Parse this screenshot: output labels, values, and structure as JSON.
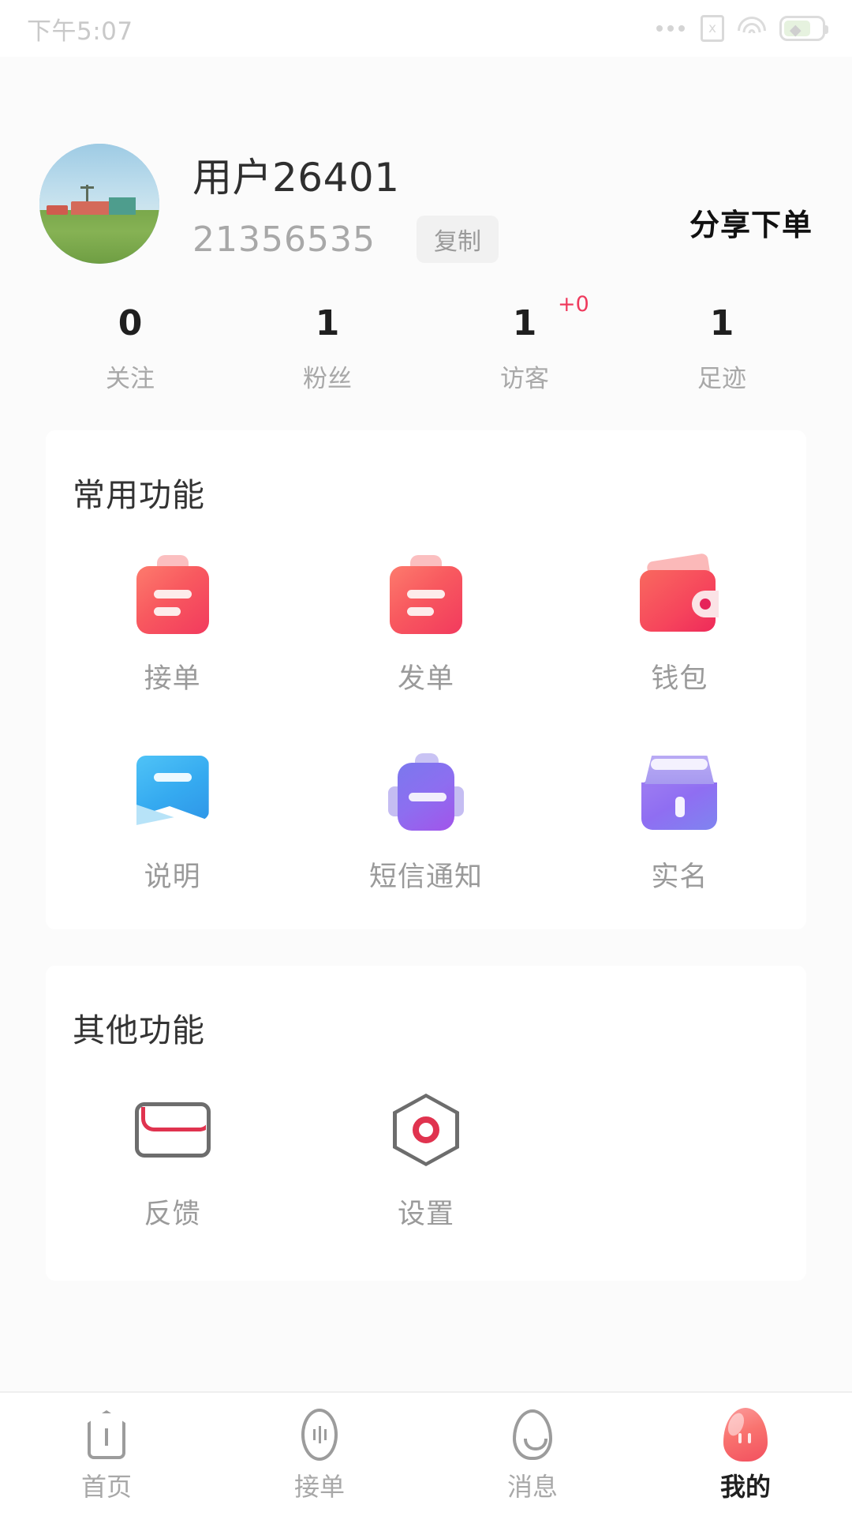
{
  "statusbar": {
    "time": "下午5:07",
    "icons": [
      "more-dots-icon",
      "sim-no-card-icon",
      "wifi-icon",
      "battery-charging-icon"
    ]
  },
  "profile": {
    "avatar_alt": "user-avatar-photo",
    "username": "用户26401",
    "user_id": "21356535",
    "copy_label": "复制",
    "share_label": "分享下单"
  },
  "stats": [
    {
      "value": "0",
      "label": "关注",
      "badge": ""
    },
    {
      "value": "1",
      "label": "粉丝",
      "badge": ""
    },
    {
      "value": "1",
      "label": "访客",
      "badge": "+0"
    },
    {
      "value": "1",
      "label": "足迹",
      "badge": ""
    }
  ],
  "common_section": {
    "title": "常用功能",
    "items": [
      {
        "label": "接单",
        "icon": "clipboard-red-icon"
      },
      {
        "label": "发单",
        "icon": "clipboard-red-icon"
      },
      {
        "label": "钱包",
        "icon": "wallet-red-icon"
      },
      {
        "label": "说明",
        "icon": "speech-note-blue-icon"
      },
      {
        "label": "短信通知",
        "icon": "sms-robot-purple-icon"
      },
      {
        "label": "实名",
        "icon": "shop-purple-icon"
      }
    ]
  },
  "other_section": {
    "title": "其他功能",
    "items": [
      {
        "label": "反馈",
        "icon": "envelope-icon"
      },
      {
        "label": "设置",
        "icon": "hexagon-settings-icon"
      }
    ]
  },
  "tabbar": {
    "items": [
      {
        "label": "首页",
        "icon": "home-icon",
        "active": false
      },
      {
        "label": "接单",
        "icon": "order-icon",
        "active": false
      },
      {
        "label": "消息",
        "icon": "message-icon",
        "active": false
      },
      {
        "label": "我的",
        "icon": "profile-icon",
        "active": true
      }
    ]
  },
  "colors": {
    "accent_red": "#f2505f",
    "badge_red": "#ef3a5d",
    "purple": "#8f6ef2",
    "blue": "#35aaf0",
    "page_bg": "#fbfbfb",
    "card_bg": "#ffffff"
  }
}
